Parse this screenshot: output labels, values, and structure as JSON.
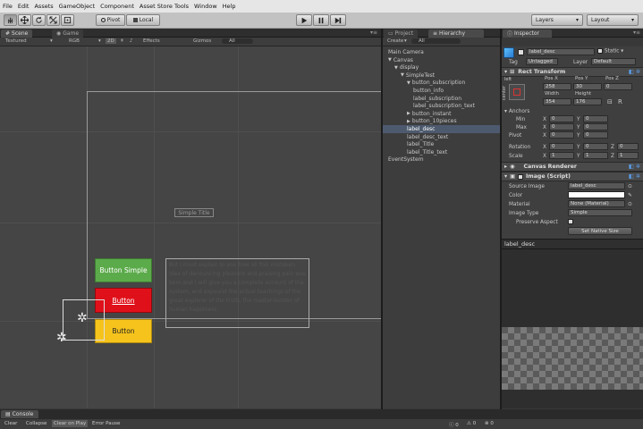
{
  "menu": [
    "File",
    "Edit",
    "Assets",
    "GameObject",
    "Component",
    "Asset Store Tools",
    "Window",
    "Help"
  ],
  "toolbar": {
    "pivot": "Pivot",
    "local": "Local",
    "layers": "Layers",
    "layout": "Layout"
  },
  "scene": {
    "tab_scene": "Scene",
    "tab_game": "Game",
    "shading": "Textured",
    "render_mode": "RGB",
    "mode_2d": "2D",
    "effects": "Effects",
    "gizmos": "Gizmos",
    "search_placeholder": "All",
    "label_title": "Simple Title",
    "button_simple": "Button Simple",
    "button_red": "Button",
    "button_yellow": "Button",
    "desc_text": "But I must explain to you how all this mistaken idea of denouncing pleasure and praising pain was born and I will give you a complete account of the system, and expound the actual teachings of the great explorer of the truth, the master-builder of human happiness."
  },
  "project": {
    "tab_project": "Project",
    "tab_hierarchy": "Hierarchy",
    "create": "Create",
    "search_placeholder": "All",
    "tree": [
      {
        "label": "Main Camera",
        "indent": 0,
        "arrow": ""
      },
      {
        "label": "Canvas",
        "indent": 0,
        "arrow": "▼"
      },
      {
        "label": "display",
        "indent": 1,
        "arrow": "▼"
      },
      {
        "label": "SimpleTest",
        "indent": 2,
        "arrow": "▼"
      },
      {
        "label": "button_subscription",
        "indent": 3,
        "arrow": "▼"
      },
      {
        "label": "button_info",
        "indent": 4,
        "arrow": ""
      },
      {
        "label": "label_subscription",
        "indent": 4,
        "arrow": ""
      },
      {
        "label": "label_subscription_text",
        "indent": 4,
        "arrow": ""
      },
      {
        "label": "button_instant",
        "indent": 3,
        "arrow": "▶"
      },
      {
        "label": "button_10pieces",
        "indent": 3,
        "arrow": "▶"
      },
      {
        "label": "label_desc",
        "indent": 3,
        "arrow": "",
        "selected": true
      },
      {
        "label": "label_desc_text",
        "indent": 3,
        "arrow": ""
      },
      {
        "label": "label_Title",
        "indent": 3,
        "arrow": ""
      },
      {
        "label": "label_Title_text",
        "indent": 3,
        "arrow": ""
      },
      {
        "label": "EventSystem",
        "indent": 0,
        "arrow": ""
      }
    ]
  },
  "inspector": {
    "tab": "Inspector",
    "object_name": "label_desc",
    "static_label": "Static",
    "tag_label": "Tag",
    "tag_value": "Untagged",
    "layer_label": "Layer",
    "layer_value": "Default",
    "rect_transform": "Rect Transform",
    "anchor_preset_top": "left",
    "anchor_preset_side": "center",
    "pos_x_label": "Pos X",
    "pos_y_label": "Pos Y",
    "pos_z_label": "Pos Z",
    "pos_x": "258",
    "pos_y": "30",
    "pos_z": "0",
    "width_label": "Width",
    "height_label": "Height",
    "width": "354",
    "height": "176",
    "anchors": "Anchors",
    "min": "Min",
    "max": "Max",
    "pivot": "Pivot",
    "x": "X",
    "y": "Y",
    "z": "Z",
    "min_x": "0",
    "min_y": "0",
    "max_x": "0",
    "max_y": "0",
    "pivot_x": "0",
    "pivot_y": "0",
    "rotation": "Rotation",
    "rot_x": "0",
    "rot_y": "0",
    "rot_z": "0",
    "scale": "Scale",
    "scale_x": "1",
    "scale_y": "1",
    "scale_z": "1",
    "canvas_renderer": "Canvas Renderer",
    "image_script": "Image (Script)",
    "source_image_label": "Source Image",
    "source_image": "label_desc",
    "color_label": "Color",
    "material_label": "Material",
    "material": "None (Material)",
    "image_type_label": "Image Type",
    "image_type": "Simple",
    "preserve_aspect": "Preserve Aspect",
    "set_native_size": "Set Native Size"
  },
  "preview": {
    "title": "label_desc"
  },
  "console": {
    "tab": "Console",
    "clear": "Clear",
    "collapse": "Collapse",
    "clear_on_play": "Clear on Play",
    "error_pause": "Error Pause",
    "count_info": "0",
    "count_warn": "0",
    "count_err": "0"
  },
  "colors": {
    "button_green": "#5cab4b",
    "button_red": "#e0101a",
    "button_yellow": "#f6c31c",
    "selection": "#4d5a6e"
  }
}
